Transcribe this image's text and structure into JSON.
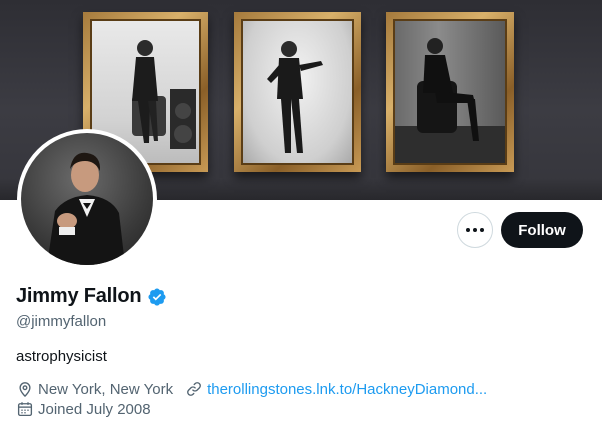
{
  "profile": {
    "display_name": "Jimmy Fallon",
    "handle": "@jimmyfallon",
    "bio": "astrophysicist",
    "location": "New York, New York",
    "website": "therollingstones.lnk.to/HackneyDiamond...",
    "joined": "Joined July 2008",
    "verified": true
  },
  "actions": {
    "follow_label": "Follow",
    "more_icon": "more-horizontal-icon"
  },
  "icons": {
    "verified": "verified-badge-icon",
    "location": "location-pin-icon",
    "link": "link-icon",
    "calendar": "calendar-icon"
  },
  "colors": {
    "text_primary": "#0f1419",
    "text_secondary": "#536471",
    "link": "#1d9bf0",
    "verified": "#1d9bf0",
    "follow_button_bg": "#0f1419",
    "follow_button_text": "#ffffff"
  }
}
